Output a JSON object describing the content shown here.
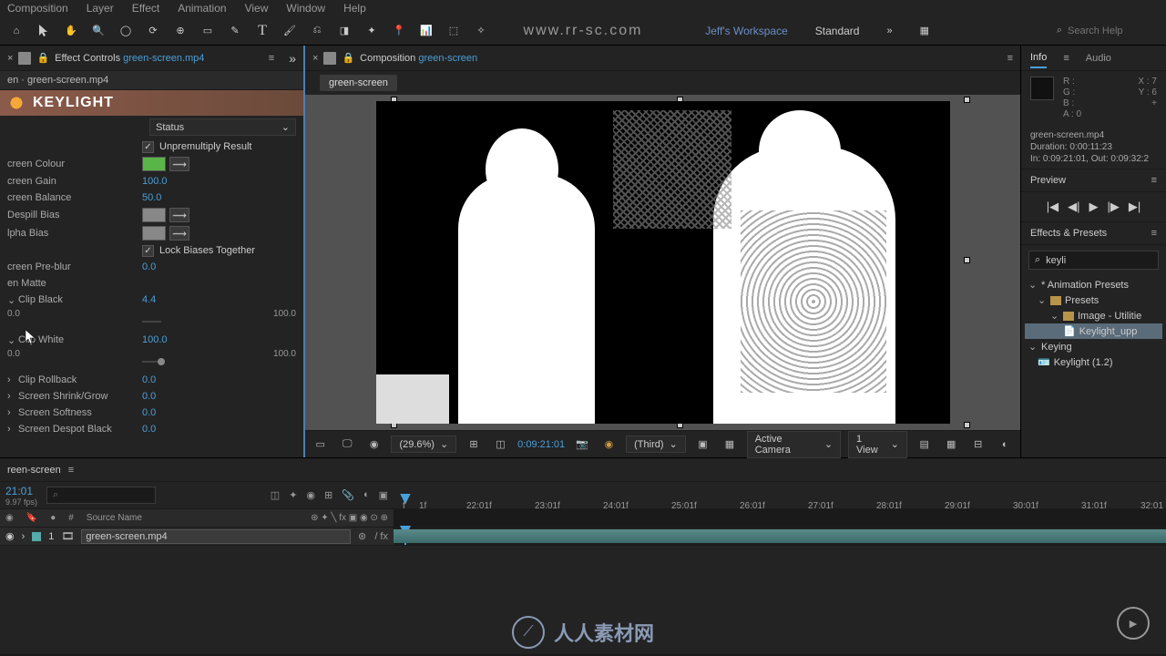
{
  "menu": {
    "items": [
      "Composition",
      "Layer",
      "Effect",
      "Animation",
      "View",
      "Window",
      "Help"
    ]
  },
  "watermark_top": "www.rr-sc.com",
  "workspace": {
    "name": "Jeff's Workspace",
    "mode": "Standard"
  },
  "help_search_placeholder": "Search Help",
  "effect_panel": {
    "title_prefix": "Effect Controls ",
    "title_link": "green-screen.mp4",
    "subheader": "en · green-screen.mp4",
    "logo_text": "KEYLIGHT",
    "status_label": "Status",
    "unpremult": "Unpremultiply Result",
    "lock_biases": "Lock Biases Together",
    "props": {
      "screen_colour": "creen Colour",
      "screen_gain": "creen Gain",
      "screen_gain_v": "100.0",
      "screen_balance": "creen Balance",
      "screen_balance_v": "50.0",
      "despill": "Despill Bias",
      "alpha": "lpha Bias",
      "preblur": "creen Pre-blur",
      "preblur_v": "0.0",
      "matte": "en Matte",
      "clip_black": "Clip Black",
      "clip_black_v": "4.4",
      "clip_white": "Clip White",
      "clip_white_v": "100.0",
      "rollback": "Clip Rollback",
      "rollback_v": "0.0",
      "shrink": "Screen Shrink/Grow",
      "shrink_v": "0.0",
      "softness": "Screen Softness",
      "softness_v": "0.0",
      "despot": "Screen Despot Black",
      "despot_v": "0.0",
      "range_min": "0.0",
      "range_max": "100.0"
    }
  },
  "comp": {
    "title_prefix": "Composition ",
    "title_link": "green-screen",
    "tab": "green-screen"
  },
  "viewer_bar": {
    "zoom": "(29.6%)",
    "timecode": "0:09:21:01",
    "resolution": "(Third)",
    "camera": "Active Camera",
    "view": "1 View"
  },
  "info": {
    "tab1": "Info",
    "tab2": "Audio",
    "r": "R :",
    "g": "G :",
    "b": "B :",
    "a": "A :   0",
    "x": "X :  7",
    "y": "Y :  6",
    "plus": "+",
    "file": "green-screen.mp4",
    "duration": "Duration: 0:00:11:23",
    "inout": "In: 0:09:21:01, Out: 0:09:32:2"
  },
  "preview": {
    "title": "Preview"
  },
  "effects_presets": {
    "title": "Effects & Presets",
    "search": "keyli",
    "tree": {
      "anim": "* Animation Presets",
      "presets": "Presets",
      "img_util": "Image - Utilitie",
      "keylight_upp": "Keylight_upp",
      "keying": "Keying",
      "keylight12": "Keylight (1.2)"
    }
  },
  "timeline": {
    "tab": "reen-screen",
    "timecode": "21:01",
    "fps": "9.97 fps)",
    "source_name": "Source Name",
    "layer1_num": "1",
    "layer1_name": "green-screen.mp4",
    "ticks": [
      "f",
      "1f",
      "22:01f",
      "23:01f",
      "24:01f",
      "25:01f",
      "26:01f",
      "27:01f",
      "28:01f",
      "29:01f",
      "30:01f",
      "31:01f",
      "32:01"
    ]
  },
  "footer_wm": "人人素材网"
}
